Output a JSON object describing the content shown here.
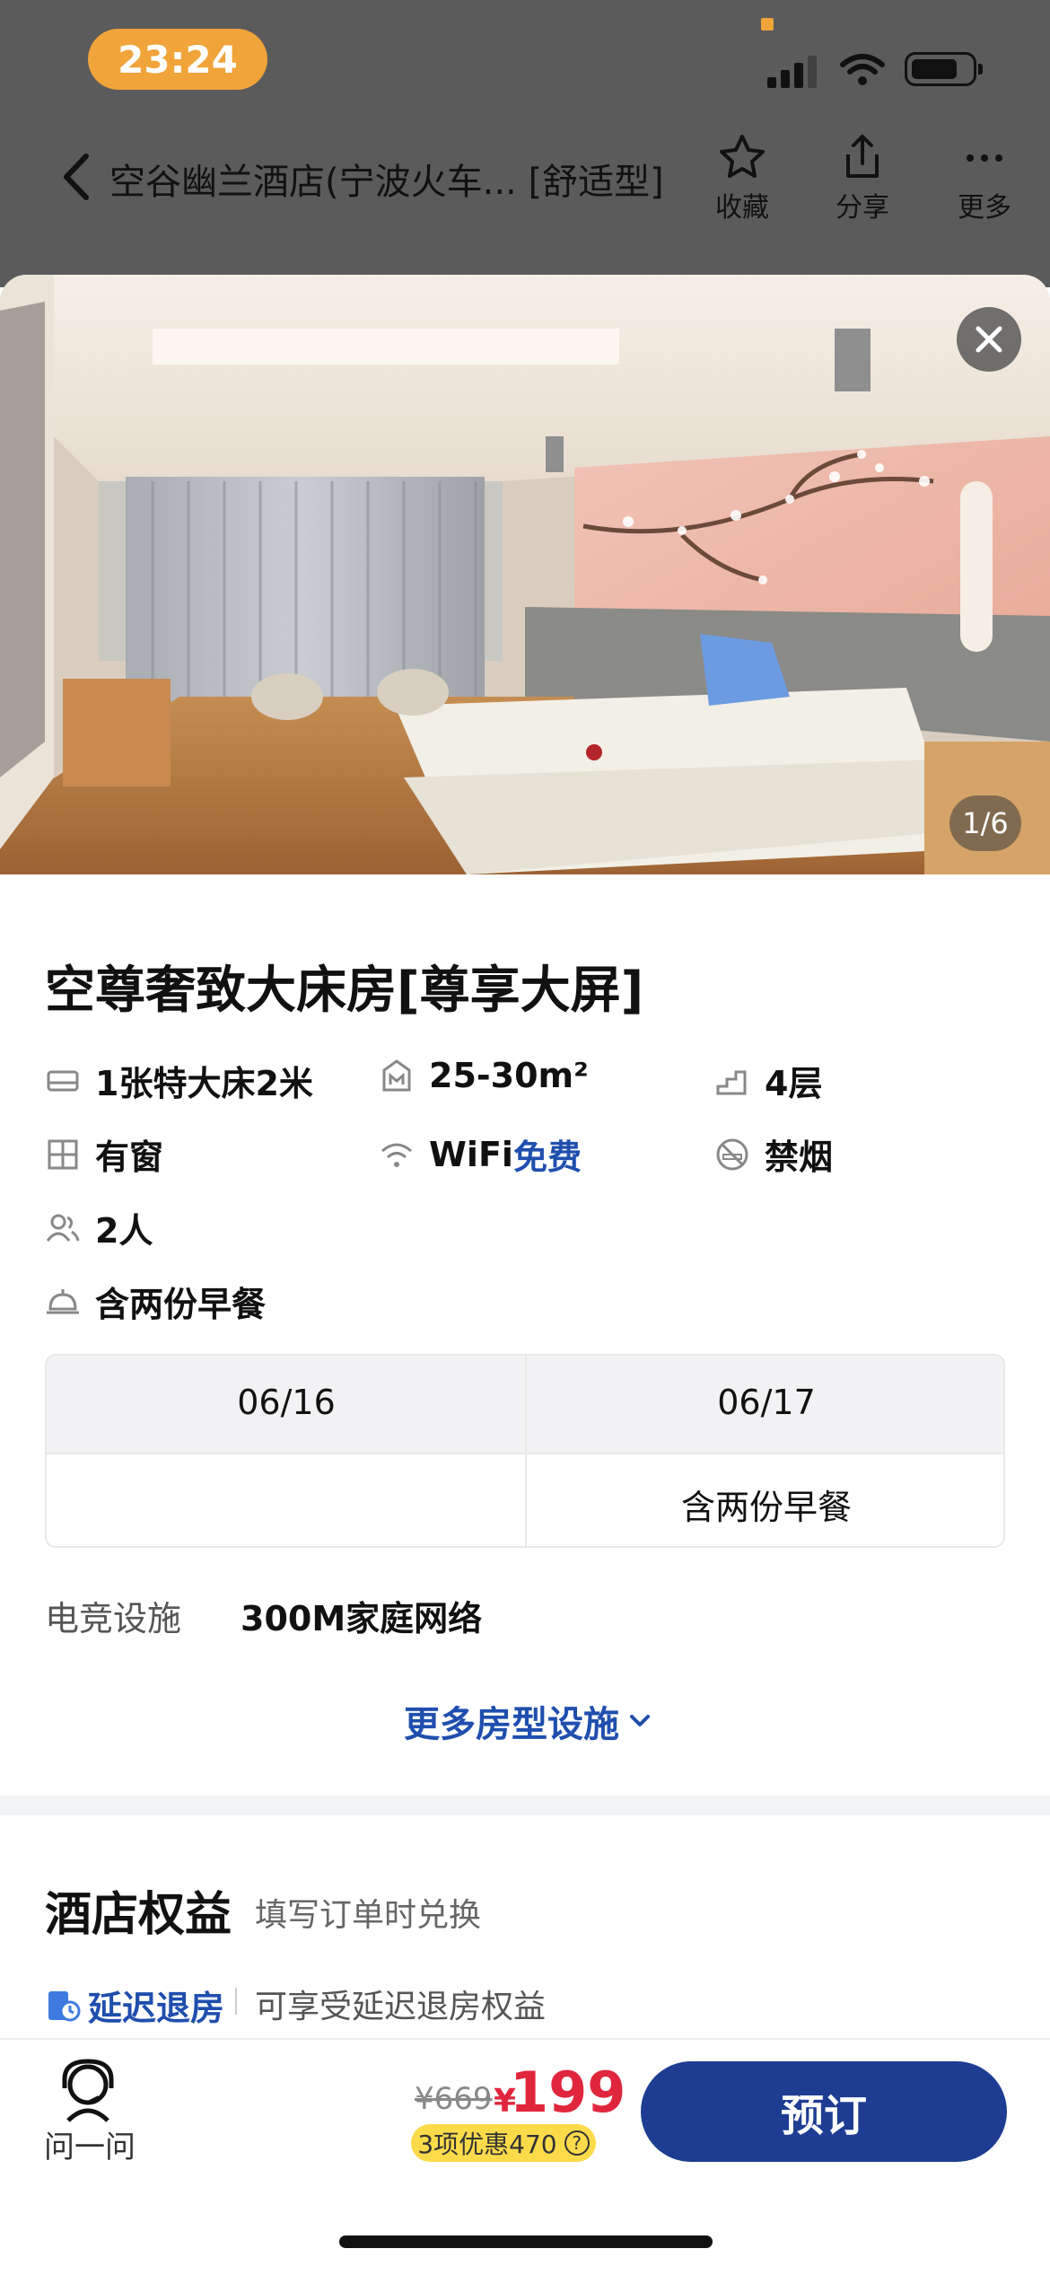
{
  "status_bar": {
    "time": "23:24"
  },
  "nav": {
    "title": "空谷幽兰酒店(宁波火车... [舒适型]",
    "actions": [
      {
        "icon": "star-icon",
        "label": "收藏"
      },
      {
        "icon": "share-icon",
        "label": "分享"
      },
      {
        "icon": "more-icon",
        "label": "更多"
      }
    ]
  },
  "gallery": {
    "counter": "1/6"
  },
  "room": {
    "title": "空尊奢致大床房[尊享大屏]",
    "features": {
      "bed": "1张特大床2米",
      "area": "25-30m²",
      "floor": "4层",
      "window": "有窗",
      "wifi_prefix": "WiFi",
      "wifi_free": "免费",
      "smoking": "禁烟",
      "occupancy": "2人",
      "breakfast": "含两份早餐"
    },
    "dates": [
      {
        "date": "06/16",
        "meal": ""
      },
      {
        "date": "06/17",
        "meal": "含两份早餐"
      }
    ],
    "esports_label": "电竞设施",
    "esports_value": "300M家庭网络",
    "more_link": "更多房型设施"
  },
  "perks": {
    "title": "酒店权益",
    "subtitle": "填写订单时兑换",
    "late_checkout_label": "延迟退房",
    "late_checkout_desc": "可享受延迟退房权益"
  },
  "bottom": {
    "ask_label": "问一问",
    "original_price": "¥669",
    "currency": "¥",
    "price": "199",
    "discount": "3项优惠470",
    "discount_help": "?",
    "book_label": "预订"
  },
  "colors": {
    "brand_blue": "#1e3d92",
    "link_blue": "#1f4fae",
    "price_red": "#e0263d",
    "discount_yellow": "#fbdb4a",
    "time_badge": "#f0a43a"
  }
}
